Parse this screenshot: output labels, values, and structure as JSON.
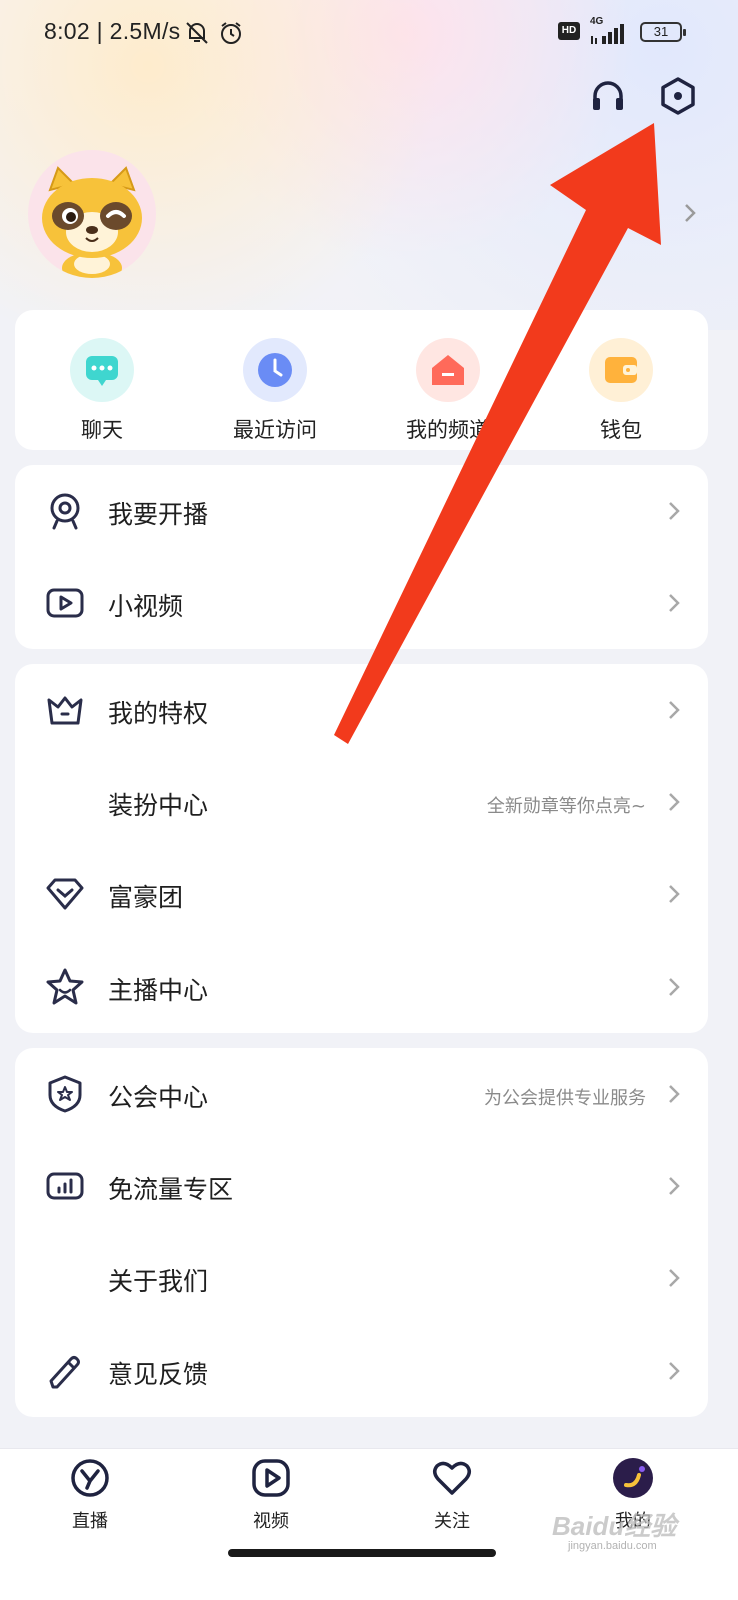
{
  "status_bar": {
    "time": "8:02 | 2.5M/s",
    "hd": "HD",
    "network": "4G",
    "battery": "31"
  },
  "header": {
    "headphones_icon": "headphones-icon",
    "settings_icon": "settings-hexagon-icon"
  },
  "quick_actions": [
    {
      "label": "聊天",
      "icon": "chat-icon",
      "color": "#3fd6cf"
    },
    {
      "label": "最近访问",
      "icon": "clock-icon",
      "color": "#6a8cf5"
    },
    {
      "label": "我的频道",
      "icon": "channel-home-icon",
      "color": "#ff6a5a"
    },
    {
      "label": "钱包",
      "icon": "wallet-icon",
      "color": "#ffb23c"
    }
  ],
  "menu_group_1": [
    {
      "label": "我要开播",
      "icon": "webcam-icon"
    },
    {
      "label": "小视频",
      "icon": "video-play-icon"
    }
  ],
  "menu_group_2": [
    {
      "label": "我的特权",
      "icon": "crown-icon"
    },
    {
      "label": "装扮中心",
      "sub": "全新勋章等你点亮~"
    },
    {
      "label": "富豪团",
      "icon": "diamond-icon"
    },
    {
      "label": "主播中心",
      "icon": "star-icon"
    }
  ],
  "menu_group_3": [
    {
      "label": "公会中心",
      "sub": "为公会提供专业服务",
      "icon": "shield-star-icon"
    },
    {
      "label": "免流量专区",
      "icon": "data-chart-icon"
    },
    {
      "label": "关于我们"
    },
    {
      "label": "意见反馈",
      "icon": "pencil-icon"
    }
  ],
  "bottom_nav": [
    {
      "label": "直播",
      "icon": "live-y-icon"
    },
    {
      "label": "视频",
      "icon": "video-tab-icon"
    },
    {
      "label": "关注",
      "icon": "heart-icon"
    },
    {
      "label": "我的",
      "icon": "profile-avatar-icon"
    }
  ],
  "watermark": {
    "text": "Baidu经验",
    "sub": "jingyan.baidu.com"
  },
  "colors": {
    "annotation_arrow": "#f23a1c",
    "accent_dark": "#2a2d4a"
  }
}
